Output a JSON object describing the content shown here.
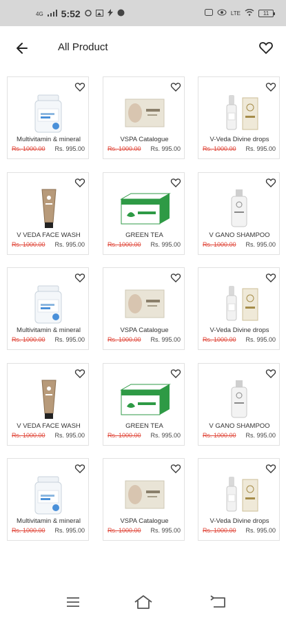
{
  "status": {
    "time": "5:52",
    "battery": "11",
    "net_left": "4G",
    "net_right": "LTE"
  },
  "header": {
    "title": "All Product"
  },
  "products": [
    {
      "name": "Multivitamin & mineral",
      "mrp": "Rs. 1000.00",
      "price": "Rs. 995.00",
      "image": "bottle-image"
    },
    {
      "name": "VSPA Catalogue",
      "mrp": "Rs. 1000.00",
      "price": "Rs. 995.00",
      "image": "catalogue-image"
    },
    {
      "name": "V-Veda Divine drops",
      "mrp": "Rs. 1000.00",
      "price": "Rs. 995.00",
      "image": "drops-image"
    },
    {
      "name": "V VEDA FACE WASH",
      "mrp": "Rs. 1000.00",
      "price": "Rs. 995.00",
      "image": "tube-image"
    },
    {
      "name": "GREEN TEA",
      "mrp": "Rs. 1000.00",
      "price": "Rs. 995.00",
      "image": "green-tea-image"
    },
    {
      "name": "V GANO SHAMPOO",
      "mrp": "Rs. 1000.00",
      "price": "Rs. 995.00",
      "image": "shampoo-image"
    },
    {
      "name": "Multivitamin & mineral",
      "mrp": "Rs. 1000.00",
      "price": "Rs. 995.00",
      "image": "bottle-image"
    },
    {
      "name": "VSPA Catalogue",
      "mrp": "Rs. 1000.00",
      "price": "Rs. 995.00",
      "image": "catalogue-image"
    },
    {
      "name": "V-Veda Divine drops",
      "mrp": "Rs. 1000.00",
      "price": "Rs. 995.00",
      "image": "drops-image"
    },
    {
      "name": "V VEDA FACE WASH",
      "mrp": "Rs. 1000.00",
      "price": "Rs. 995.00",
      "image": "tube-image"
    },
    {
      "name": "GREEN TEA",
      "mrp": "Rs. 1000.00",
      "price": "Rs. 995.00",
      "image": "green-tea-image"
    },
    {
      "name": "V GANO SHAMPOO",
      "mrp": "Rs. 1000.00",
      "price": "Rs. 995.00",
      "image": "shampoo-image"
    },
    {
      "name": "Multivitamin & mineral",
      "mrp": "Rs. 1000.00",
      "price": "Rs. 995.00",
      "image": "bottle-image"
    },
    {
      "name": "VSPA Catalogue",
      "mrp": "Rs. 1000.00",
      "price": "Rs. 995.00",
      "image": "catalogue-image"
    },
    {
      "name": "V-Veda Divine drops",
      "mrp": "Rs. 1000.00",
      "price": "Rs. 995.00",
      "image": "drops-image"
    }
  ],
  "colors": {
    "mrp": "#e0473a",
    "card_border": "#e1e1e1",
    "status_bar": "#d7d7d7",
    "tea_box": "#2e9a45"
  }
}
